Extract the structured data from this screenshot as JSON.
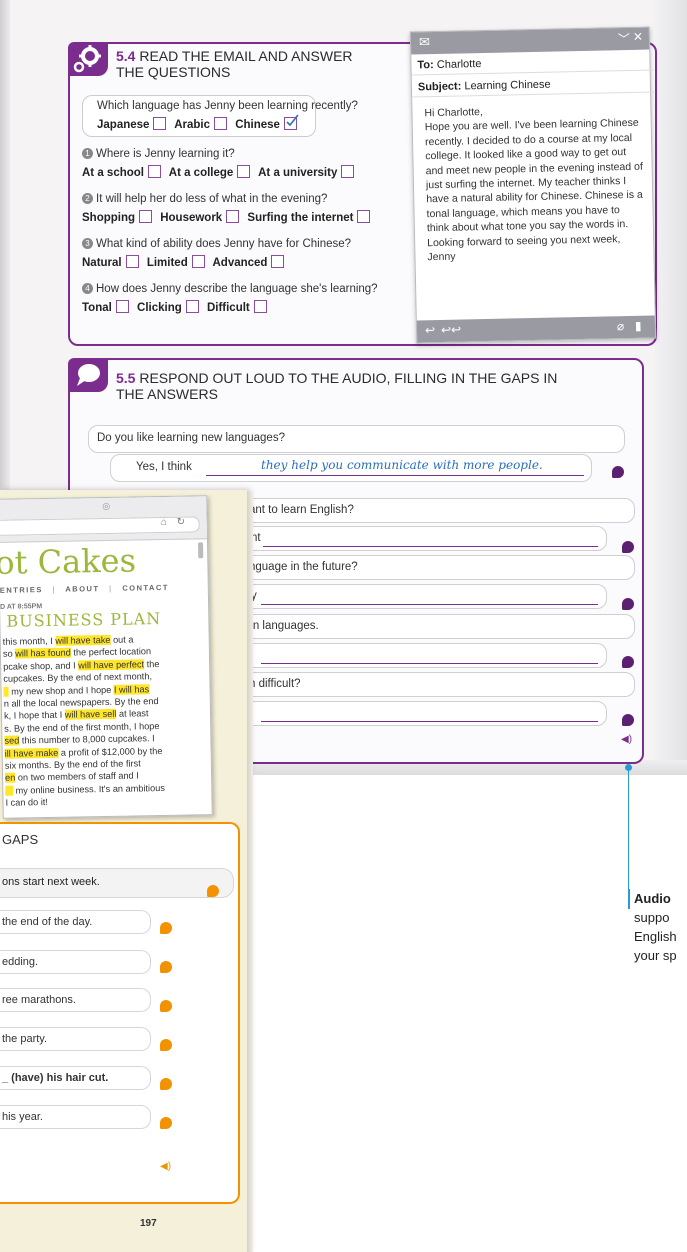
{
  "exercise_54": {
    "number": "5.4",
    "title_line1": "READ THE EMAIL AND ANSWER",
    "title_line2": "THE QUESTIONS",
    "example": {
      "question": "Which language has Jenny been learning recently?",
      "options": [
        "Japanese",
        "Arabic",
        "Chinese"
      ],
      "checked": "Chinese"
    },
    "questions": [
      {
        "num": "1",
        "text": "Where is Jenny learning it?",
        "options": [
          "At a school",
          "At a college",
          "At a university"
        ]
      },
      {
        "num": "2",
        "text": "It will help her do less of what in the evening?",
        "options": [
          "Shopping",
          "Housework",
          "Surfing the internet"
        ]
      },
      {
        "num": "3",
        "text": "What kind of ability does Jenny have for Chinese?",
        "options": [
          "Natural",
          "Limited",
          "Advanced"
        ]
      },
      {
        "num": "4",
        "text": "How does Jenny describe the language she's learning?",
        "options": [
          "Tonal",
          "Clicking",
          "Difficult"
        ]
      }
    ]
  },
  "email": {
    "to_label": "To:",
    "to": "Charlotte",
    "subject_label": "Subject:",
    "subject": "Learning Chinese",
    "body_lines": [
      "Hi Charlotte,",
      "Hope you are well. I've been learning Chinese",
      "recently. I decided to do a course at my local",
      "college. It looked like a good way to get out",
      "and meet new people in the evening instead of",
      "just surfing the internet. My teacher thinks I",
      "have a natural ability for Chinese. Chinese is a",
      "tonal language, which means you have to",
      "think about what tone you say the words in.",
      "Looking forward to seeing you next week,",
      "Jenny"
    ]
  },
  "exercise_55": {
    "number": "5.5",
    "title_line1": "RESPOND OUT LOUD TO THE AUDIO, FILLING IN THE GAPS IN",
    "title_line2": "THE ANSWERS",
    "example": {
      "question": "Do you like learning new languages?",
      "answer_start": "Yes, I think",
      "answer_fill": "they help you communicate with more people."
    },
    "visible_prompts": [
      {
        "q": "ant to learn English?",
        "a": "nt"
      },
      {
        "q": "nguage in the future?",
        "a": "y"
      },
      {
        "q": "rn languages.",
        "a": ""
      },
      {
        "q": "h difficult?",
        "a": ""
      }
    ]
  },
  "blog": {
    "title": "ot Cakes",
    "nav": [
      "ENTRIES",
      "ABOUT",
      "CONTACT"
    ],
    "date": "D AT 8:55PM",
    "post_title": "BUSINESS PLAN",
    "post_lines": [
      {
        "pre": "this month, I ",
        "hl": "will have take",
        "post": " out a"
      },
      {
        "pre": "so ",
        "hl": "will has found",
        "post": " the perfect location"
      },
      {
        "pre": "pcake shop, and I ",
        "hl": "will have perfect",
        "post": " the"
      },
      {
        "pre": " cupcakes. By the end of next month,",
        "hl": "",
        "post": ""
      },
      {
        "pre": "",
        "hl": "",
        "post": " my new shop and I hope ",
        "hl2": "I will has"
      },
      {
        "pre": "n all the local newspapers. By the end",
        "hl": "",
        "post": ""
      },
      {
        "pre": "k, I hope that I ",
        "hl": "will have sell",
        "post": " at least"
      },
      {
        "pre": "s. By the end of the first month, I hope",
        "hl": "",
        "post": ""
      },
      {
        "pre": "",
        "hl": "sed",
        "post": " this number to 8,000 cupcakes. I"
      },
      {
        "pre": "",
        "hl": "ill have make",
        "post": " a profit of $12,000 by the"
      },
      {
        "pre": "six months. By the end of the first",
        "hl": "",
        "post": ""
      },
      {
        "pre": "",
        "hl": "en",
        "post": " on two members of staff and I"
      },
      {
        "pre": "",
        "hl": "",
        "post": " my online business. It's an ambitious"
      },
      {
        "pre": " I can do it!",
        "hl": "",
        "post": ""
      }
    ]
  },
  "exercise_orange": {
    "title": "GAPS",
    "items": [
      "ons start next week.",
      "the end of the day.",
      "edding.",
      "ree marathons.",
      "the party.",
      "_ (have) his hair cut.",
      "his year."
    ]
  },
  "page_number": "197",
  "annotation": {
    "bold": "Audio",
    "lines": [
      "suppo",
      "English",
      "your sp"
    ]
  },
  "colors": {
    "purple": "#7b2d8e",
    "orange": "#f39200",
    "blue": "#2a9ad6",
    "blog_green": "#9ab83b",
    "highlight": "#ffe629"
  }
}
